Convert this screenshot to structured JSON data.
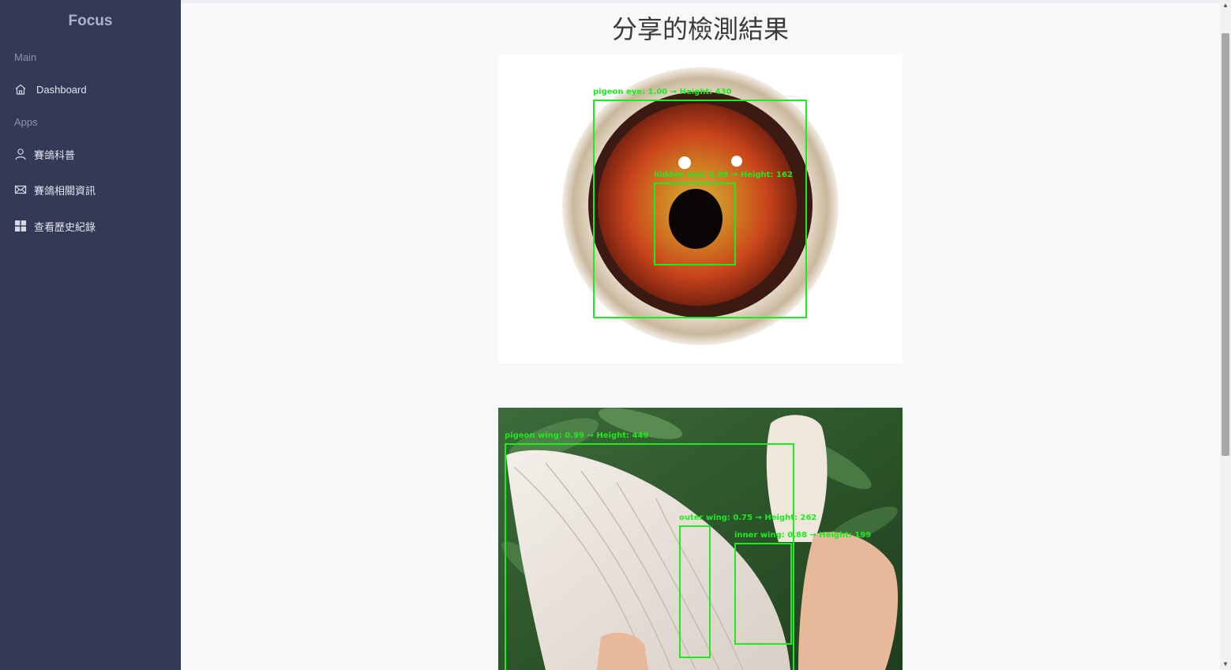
{
  "sidebar": {
    "brand": "Focus",
    "sections": [
      {
        "label": "Main"
      },
      {
        "label": "Apps"
      }
    ],
    "items": [
      {
        "label": "Dashboard",
        "icon": "home-icon"
      },
      {
        "label": "賽鴿科普",
        "icon": "user-icon"
      },
      {
        "label": "賽鴿相關資訊",
        "icon": "mail-icon"
      },
      {
        "label": "查看歷史紀錄",
        "icon": "grid-icon"
      }
    ]
  },
  "main": {
    "title": "分享的檢測結果",
    "results": [
      {
        "subject": "pigeon eye",
        "detections": [
          {
            "label": "pigeon eye: 1.00 → Height: 430"
          },
          {
            "label": "hidden eye: 0.99 → Height: 162"
          }
        ]
      },
      {
        "subject": "pigeon wing",
        "detections": [
          {
            "label": "pigeon wing: 0.99 → Height: 449"
          },
          {
            "label": "outer wing: 0.75 → Height: 262"
          },
          {
            "label": "inner wing: 0.88 → Height: 199"
          }
        ]
      }
    ]
  },
  "colors": {
    "sidebar_bg": "#343957",
    "detection_box": "#1eeb1e",
    "page_bg": "#f7f8fa"
  }
}
